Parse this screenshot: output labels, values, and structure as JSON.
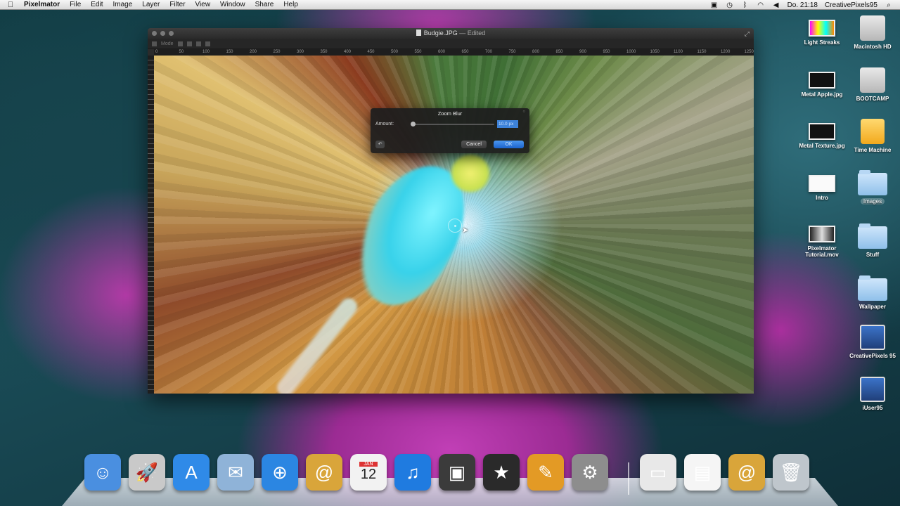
{
  "menubar": {
    "apple_icon": "apple-icon",
    "app_name": "Pixelmator",
    "items": [
      "File",
      "Edit",
      "Image",
      "Layer",
      "Filter",
      "View",
      "Window",
      "Share",
      "Help"
    ],
    "clock": "Do. 21:18",
    "user": "CreativePixels95",
    "status_icons": [
      "screen-icon",
      "time-machine-icon",
      "bluetooth-icon",
      "wifi-icon",
      "volume-icon",
      "spotlight-icon"
    ]
  },
  "window": {
    "title": "Budgie.JPG",
    "edited": "— Edited",
    "toolbar_mode_label": "Mode",
    "ruler_ticks": [
      "0",
      "50",
      "100",
      "150",
      "200",
      "250",
      "300",
      "350",
      "400",
      "450",
      "500",
      "550",
      "600",
      "650",
      "700",
      "750",
      "800",
      "850",
      "900",
      "950",
      "1000",
      "1050",
      "1100",
      "1150",
      "1200",
      "1250"
    ]
  },
  "dialog": {
    "title": "Zoom Blur",
    "amount_label": "Amount:",
    "amount_value": "10.0 px",
    "amount_fraction": 0.02,
    "cancel_label": "Cancel",
    "ok_label": "OK",
    "reset_icon": "undo-icon"
  },
  "desktop_icons": [
    {
      "label": "Light Streaks",
      "type": "thumb"
    },
    {
      "label": "Macintosh HD",
      "type": "drive"
    },
    {
      "label": "Metal Apple.jpg",
      "type": "thumb"
    },
    {
      "label": "BOOTCAMP",
      "type": "drive"
    },
    {
      "label": "Metal Texture.jpg",
      "type": "thumb"
    },
    {
      "label": "Time Machine",
      "type": "time-machine"
    },
    {
      "label": "Intro",
      "type": "thumb"
    },
    {
      "label": "Images",
      "type": "folder"
    },
    {
      "label": "Pixelmator Tutorial.mov",
      "type": "thumb"
    },
    {
      "label": "Stuff",
      "type": "folder"
    },
    {
      "label": "Wallpaper",
      "type": "folder"
    },
    {
      "label": "CreativePixels 95",
      "type": "app"
    },
    {
      "label": "iUser95",
      "type": "app"
    }
  ],
  "dock": {
    "items": [
      {
        "icon": "finder-icon",
        "color": "#4a8fe0",
        "glyph": "☺"
      },
      {
        "icon": "launchpad-icon",
        "color": "#c9c9c9",
        "glyph": "🚀"
      },
      {
        "icon": "app-store-icon",
        "color": "#2f8ae8",
        "glyph": "A"
      },
      {
        "icon": "mail-icon",
        "color": "#8fb3d8",
        "glyph": "✉"
      },
      {
        "icon": "safari-icon",
        "color": "#2b86e2",
        "glyph": "⊕"
      },
      {
        "icon": "address-book-icon",
        "color": "#d9a53a",
        "glyph": "@"
      },
      {
        "icon": "calendar-icon",
        "color": "#f2f2f2",
        "glyph": "12",
        "month": "JAN"
      },
      {
        "icon": "itunes-icon",
        "color": "#1f7be0",
        "glyph": "♫"
      },
      {
        "icon": "iphoto-icon",
        "color": "#3b3b3b",
        "glyph": "▣"
      },
      {
        "icon": "imovie-icon",
        "color": "#2a2a2a",
        "glyph": "★"
      },
      {
        "icon": "pixelmator-icon",
        "color": "#e39a25",
        "glyph": "✎"
      },
      {
        "icon": "system-preferences-icon",
        "color": "#8d8d8d",
        "glyph": "⚙"
      },
      {
        "icon": "document-stack-icon",
        "color": "#e8e8e8",
        "glyph": "▭"
      },
      {
        "icon": "pdf-document-icon",
        "color": "#f5f5f5",
        "glyph": "▤"
      },
      {
        "icon": "address-book-stack-icon",
        "color": "#d9a53a",
        "glyph": "@"
      },
      {
        "icon": "trash-icon",
        "color": "#bfc6cc",
        "glyph": "🗑"
      }
    ]
  }
}
